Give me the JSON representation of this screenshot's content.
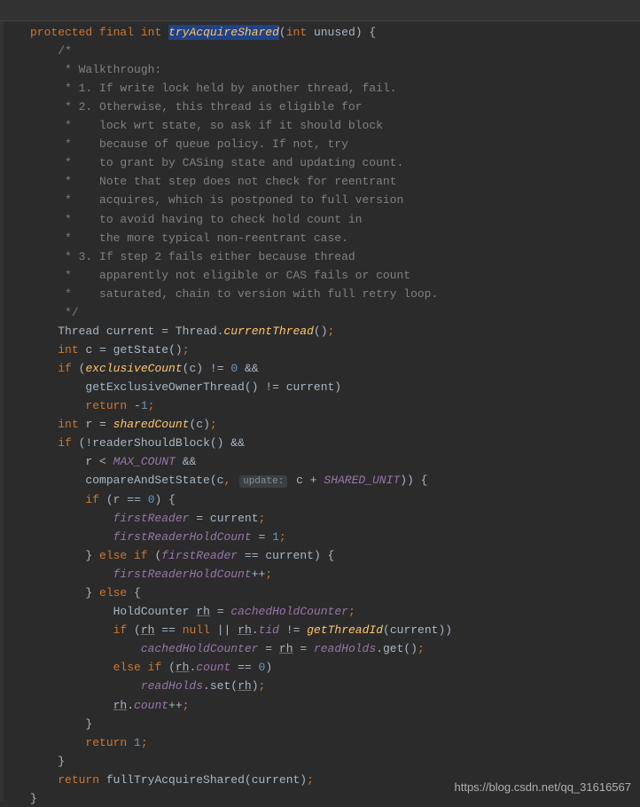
{
  "sig": {
    "mod1": "protected",
    "mod2": "final",
    "ret": "int",
    "name": "tryAcquireShared",
    "ptype": "int",
    "pname": "unused"
  },
  "comment": {
    "open": "/*",
    "l1": " * Walkthrough:",
    "l2": " * 1. If write lock held by another thread, fail.",
    "l3": " * 2. Otherwise, this thread is eligible for",
    "l4": " *    lock wrt state, so ask if it should block",
    "l5": " *    because of queue policy. If not, try",
    "l6": " *    to grant by CASing state and updating count.",
    "l7": " *    Note that step does not check for reentrant",
    "l8": " *    acquires, which is postponed to full version",
    "l9": " *    to avoid having to check hold count in",
    "l10": " *    the more typical non-reentrant case.",
    "l11": " * 3. If step 2 fails either because thread",
    "l12": " *    apparently not eligible or CAS fails or count",
    "l13": " *    saturated, chain to version with full retry loop.",
    "close": " */"
  },
  "code": {
    "thread_cls": "Thread",
    "current": "current",
    "currentThread": "currentThread",
    "int": "int",
    "c": "c",
    "getState": "getState",
    "if": "if",
    "exclusiveCount": "exclusiveCount",
    "neq": "!=",
    "zero": "0",
    "andand": "&&",
    "getExclusiveOwnerThread": "getExclusiveOwnerThread",
    "return": "return",
    "neg1": "1",
    "r": "r",
    "sharedCount": "sharedCount",
    "not": "!",
    "readerShouldBlock": "readerShouldBlock",
    "lt": "<",
    "MAX_COUNT": "MAX_COUNT",
    "compareAndSetState": "compareAndSetState",
    "hint_update": "update:",
    "plus": "+",
    "SHARED_UNIT": "SHARED_UNIT",
    "eqeq": "==",
    "firstReader": "firstReader",
    "eq": "=",
    "firstReaderHoldCount": "firstReaderHoldCount",
    "one": "1",
    "else": "else",
    "pp": "++",
    "HoldCounter": "HoldCounter",
    "rh": "rh",
    "cachedHoldCounter": "cachedHoldCounter",
    "null": "null",
    "oror": "||",
    "tid": "tid",
    "getThreadId": "getThreadId",
    "readHolds": "readHolds",
    "get": "get",
    "count": "count",
    "set": "set",
    "fullTryAcquireShared": "fullTryAcquireShared"
  },
  "watermark": "https://blog.csdn.net/qq_31616567"
}
